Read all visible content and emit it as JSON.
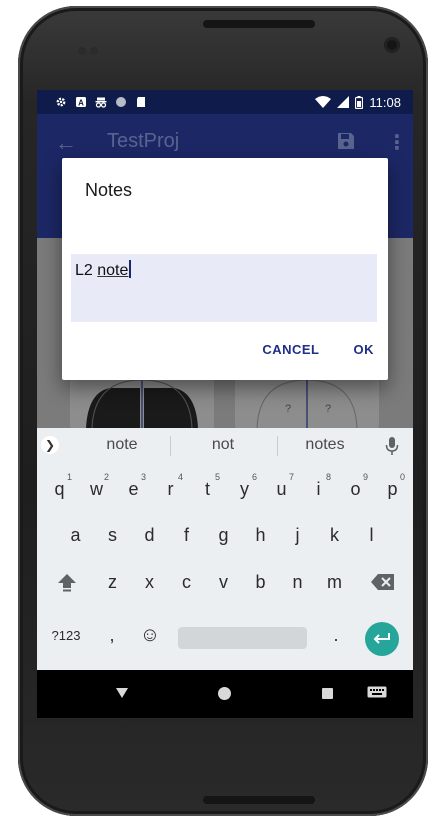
{
  "status_bar": {
    "time": "11:08"
  },
  "app_bar": {
    "title": "TestProj"
  },
  "dialog": {
    "title": "Notes",
    "input_value_plain": "L2 ",
    "input_value_underlined": "note",
    "cancel_label": "CANCEL",
    "ok_label": "OK"
  },
  "keyboard": {
    "suggestions": [
      "note",
      "not",
      "notes"
    ],
    "row1": [
      {
        "key": "q",
        "hint": "1"
      },
      {
        "key": "w",
        "hint": "2"
      },
      {
        "key": "e",
        "hint": "3"
      },
      {
        "key": "r",
        "hint": "4"
      },
      {
        "key": "t",
        "hint": "5"
      },
      {
        "key": "y",
        "hint": "6"
      },
      {
        "key": "u",
        "hint": "7"
      },
      {
        "key": "i",
        "hint": "8"
      },
      {
        "key": "o",
        "hint": "9"
      },
      {
        "key": "p",
        "hint": "0"
      }
    ],
    "row2": [
      "a",
      "s",
      "d",
      "f",
      "g",
      "h",
      "j",
      "k",
      "l"
    ],
    "row3": [
      "z",
      "x",
      "c",
      "v",
      "b",
      "n",
      "m"
    ],
    "symbols_label": "?123",
    "comma_label": ",",
    "period_label": ".",
    "emoji_label": "☺"
  },
  "colors": {
    "status_bar": "#0f1b4a",
    "app_bar_dimmed": "#1c2866",
    "accent_button_text": "#1f2f86",
    "input_background": "#e9eaf8",
    "enter_key": "#26a69a"
  },
  "icons": {
    "status_left": [
      "settings-icon",
      "a-icon",
      "incognito-icon",
      "circle-icon",
      "sd-card-icon"
    ],
    "status_right": [
      "wifi-icon",
      "signal-icon",
      "battery-icon"
    ],
    "nav": [
      "back-icon",
      "home-icon",
      "recents-icon",
      "keyboard-icon"
    ]
  }
}
